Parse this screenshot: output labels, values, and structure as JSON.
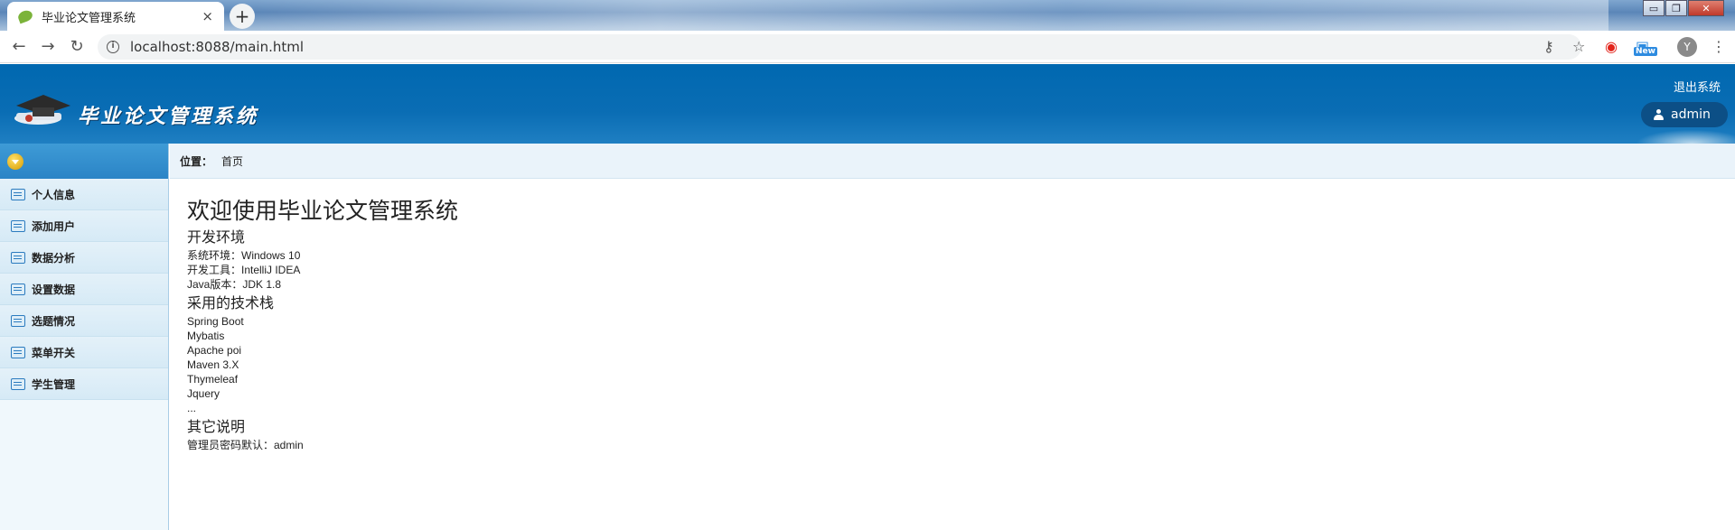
{
  "browser": {
    "tab_title": "毕业论文管理系统",
    "tab_close": "×",
    "new_tab": "+",
    "url": "localhost:8088/main.html",
    "profile_initial": "Y",
    "new_badge": "New",
    "window_controls": [
      "▭",
      "❐",
      "✕"
    ]
  },
  "header": {
    "logo_text": "毕业论文管理系统",
    "logout": "退出系统",
    "user": "admin"
  },
  "sidebar": {
    "items": [
      {
        "label": "个人信息"
      },
      {
        "label": "添加用户"
      },
      {
        "label": "数据分析"
      },
      {
        "label": "设置数据"
      },
      {
        "label": "选题情况"
      },
      {
        "label": "菜单开关"
      },
      {
        "label": "学生管理"
      }
    ]
  },
  "breadcrumb": {
    "label": "位置：",
    "current": "首页"
  },
  "main": {
    "title": "欢迎使用毕业论文管理系统",
    "env_heading": "开发环境",
    "env_lines": [
      "系统环境：Windows 10",
      "开发工具：IntelliJ IDEA",
      "Java版本：JDK 1.8"
    ],
    "tech_heading": "采用的技术栈",
    "tech_lines": [
      "Spring Boot",
      "Mybatis",
      "Apache poi",
      "Maven 3.X",
      "Thymeleaf",
      "Jquery",
      "..."
    ],
    "other_heading": "其它说明",
    "other_lines": [
      "管理员密码默认：admin"
    ]
  }
}
